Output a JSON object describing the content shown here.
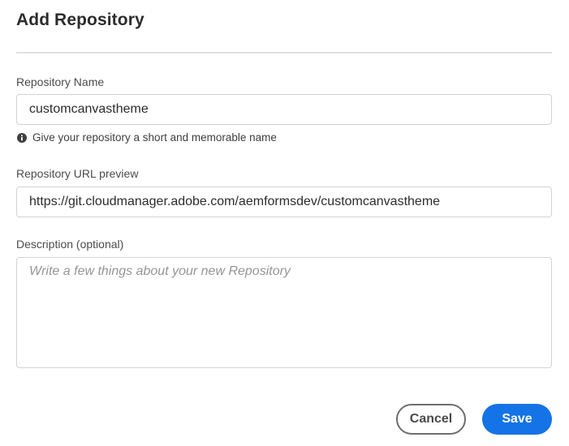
{
  "dialog": {
    "title": "Add Repository"
  },
  "repository_name": {
    "label": "Repository Name",
    "value": "customcanvastheme",
    "help_icon": "info-icon",
    "help_text": "Give your repository a short and memorable name"
  },
  "repository_url": {
    "label": "Repository URL preview",
    "value": "https://git.cloudmanager.adobe.com/aemformsdev/customcanvastheme"
  },
  "description": {
    "label": "Description (optional)",
    "placeholder": "Write a few things about your new Repository",
    "value": ""
  },
  "actions": {
    "cancel_label": "Cancel",
    "save_label": "Save"
  },
  "colors": {
    "primary": "#1473e6",
    "secondary_border": "#6e6e6e",
    "divider": "#e1e1e1",
    "field_border": "#d3d3d3"
  }
}
